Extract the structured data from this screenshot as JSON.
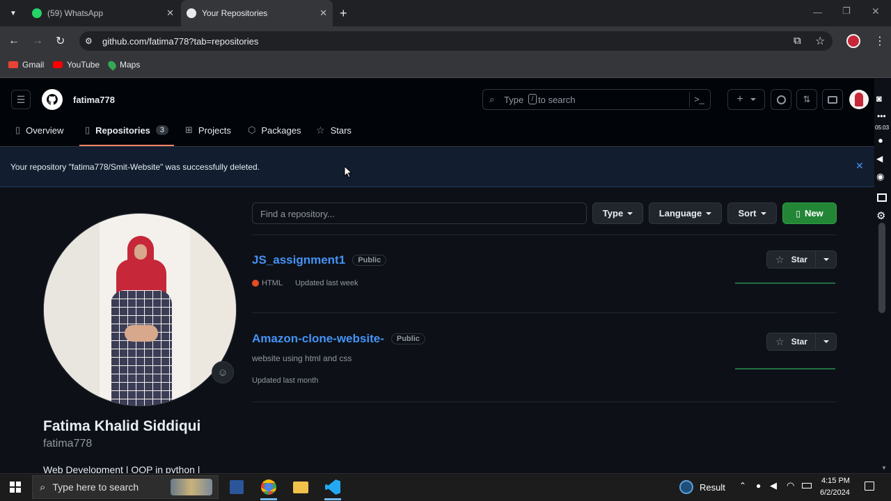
{
  "browser": {
    "tabs": [
      {
        "title": "(59) WhatsApp",
        "icon": "whatsapp-icon"
      },
      {
        "title": "Your Repositories",
        "icon": "github-icon"
      }
    ],
    "url": "github.com/fatima778?tab=repositories",
    "bookmarks": [
      "Gmail",
      "YouTube",
      "Maps"
    ]
  },
  "header": {
    "username": "fatima778",
    "search_prefix": "Type",
    "search_key": "/",
    "search_suffix": "to search"
  },
  "nav": {
    "overview": "Overview",
    "repositories": "Repositories",
    "repo_count": "3",
    "projects": "Projects",
    "packages": "Packages",
    "stars": "Stars"
  },
  "flash": {
    "message": "Your repository \"fatima778/Smit-Website\" was successfully deleted."
  },
  "filters": {
    "find_placeholder": "Find a repository...",
    "type": "Type",
    "language": "Language",
    "sort": "Sort",
    "new": "New"
  },
  "repos": [
    {
      "name": "JS_assignment1",
      "visibility": "Public",
      "language": "HTML",
      "language_color": "#e34c26",
      "updated": "Updated last week",
      "star": "Star"
    },
    {
      "name": "Amazon-clone-website-",
      "visibility": "Public",
      "description": "website using html and css",
      "updated": "Updated last month",
      "star": "Star"
    }
  ],
  "profile": {
    "full_name": "Fatima Khalid Siddiqui",
    "login": "fatima778",
    "bio": "Web Development | OOP in python |"
  },
  "taskbar": {
    "search_placeholder": "Type here to search",
    "weather": "Result",
    "time": "4:15 PM",
    "date": "6/2/2024"
  },
  "side": {
    "recording_time": "05:03"
  },
  "colors": {
    "accent_green": "#238636",
    "link_blue": "#4493f8",
    "tab_underline": "#f78166"
  }
}
